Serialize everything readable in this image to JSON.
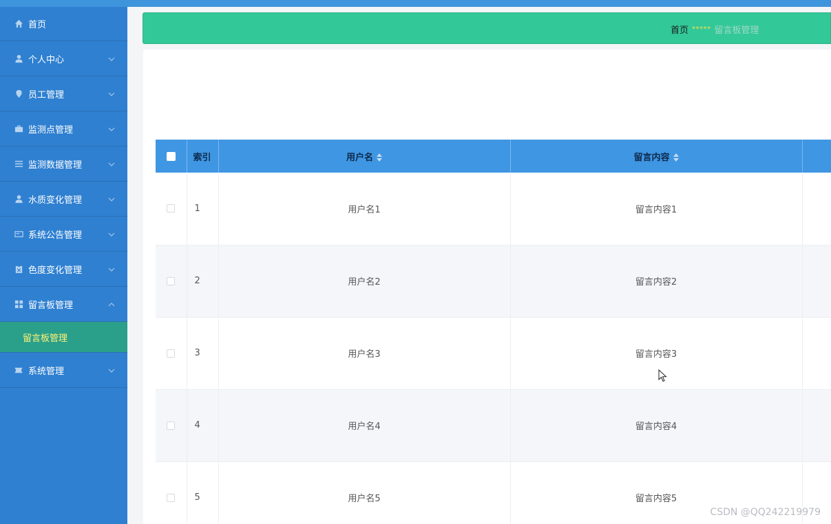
{
  "sidebar": {
    "items": [
      {
        "label": "首页",
        "icon": "home-icon"
      },
      {
        "label": "个人中心",
        "icon": "user-icon"
      },
      {
        "label": "员工管理",
        "icon": "location-icon"
      },
      {
        "label": "监测点管理",
        "icon": "briefcase-icon"
      },
      {
        "label": "监测数据管理",
        "icon": "list-icon"
      },
      {
        "label": "水质变化管理",
        "icon": "user-icon"
      },
      {
        "label": "系统公告管理",
        "icon": "card-icon"
      },
      {
        "label": "色度变化管理",
        "icon": "clipboard-icon"
      },
      {
        "label": "留言板管理",
        "icon": "grid-icon"
      },
      {
        "label": "系统管理",
        "icon": "ticket-icon"
      }
    ],
    "submenu": {
      "label": "留言板管理"
    }
  },
  "breadcrumb": {
    "home": "首页",
    "separator": "*****",
    "current": "留言板管理"
  },
  "table": {
    "headers": {
      "index": "索引",
      "username": "用户名",
      "content": "留言内容"
    },
    "rows": [
      {
        "index": "1",
        "username": "用户名1",
        "content": "留言内容1"
      },
      {
        "index": "2",
        "username": "用户名2",
        "content": "留言内容2"
      },
      {
        "index": "3",
        "username": "用户名3",
        "content": "留言内容3"
      },
      {
        "index": "4",
        "username": "用户名4",
        "content": "留言内容4"
      },
      {
        "index": "5",
        "username": "用户名5",
        "content": "留言内容5"
      }
    ]
  },
  "watermark": "CSDN @QQ242219979",
  "colors": {
    "sidebar": "#2f80d1",
    "breadcrumb_bar": "#33c898",
    "table_header": "#3f96e3",
    "submenu_active": "#2aa08a",
    "submenu_text": "#fff27a"
  }
}
